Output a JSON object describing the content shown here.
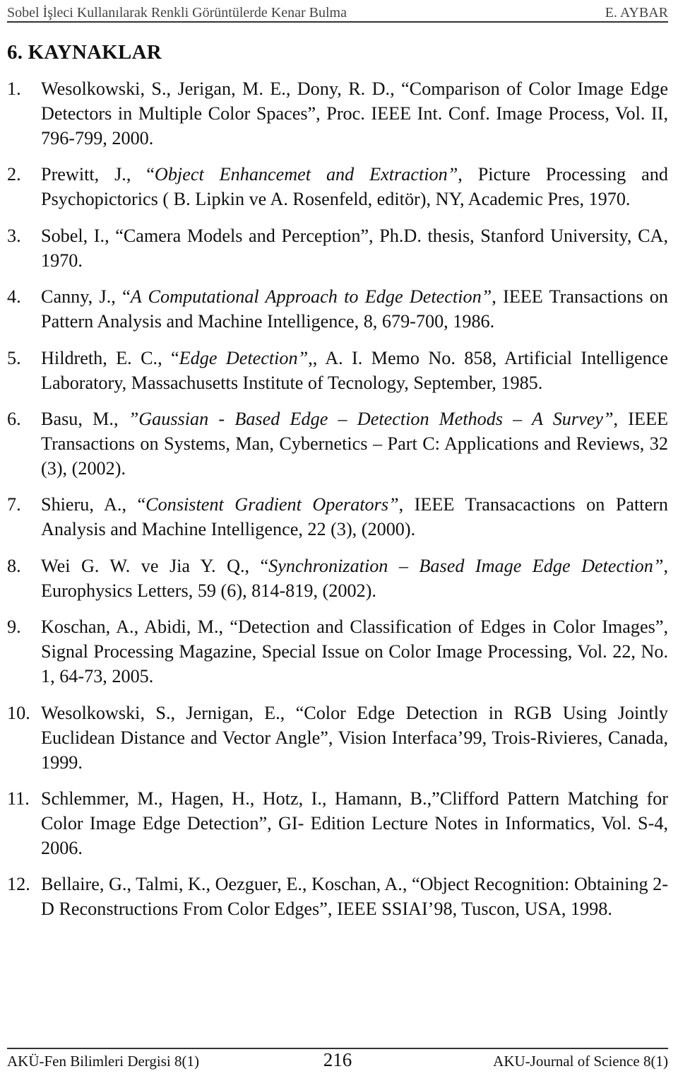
{
  "running_head": {
    "title": "Sobel İşleci Kullanılarak Renkli Görüntülerde Kenar Bulma",
    "author": "E. AYBAR"
  },
  "section_title": "6. KAYNAKLAR",
  "references": [
    {
      "number": "1.",
      "segments": [
        {
          "text": "Wesolkowski, S., Jerigan, M. E., Dony, R. D., “Comparison of Color Image Edge Detectors in Multiple Color Spaces”, Proc. IEEE Int. Conf. Image Process, Vol. II, 796-799, 2000.",
          "italic": false
        }
      ]
    },
    {
      "number": "2.",
      "segments": [
        {
          "text": "Prewitt, J., “",
          "italic": false
        },
        {
          "text": "Object Enhancemet and Extraction”",
          "italic": true
        },
        {
          "text": ", Picture Processing and Psychopictorics ( B. Lipkin ve A. Rosenfeld, editör), NY, Academic Pres, 1970.",
          "italic": false
        }
      ]
    },
    {
      "number": "3.",
      "segments": [
        {
          "text": "Sobel, I., “Camera Models and Perception”, Ph.D. thesis, Stanford University, CA, 1970.",
          "italic": false
        }
      ]
    },
    {
      "number": "4.",
      "segments": [
        {
          "text": "Canny, J., “",
          "italic": false
        },
        {
          "text": "A Computational Approach to Edge Detection”",
          "italic": true
        },
        {
          "text": ", IEEE Transactions on Pattern Analysis  and Machine Intelligence, 8, 679-700, 1986.",
          "italic": false
        }
      ]
    },
    {
      "number": "5.",
      "segments": [
        {
          "text": "Hildreth, E. C., “",
          "italic": false
        },
        {
          "text": "Edge Detection”",
          "italic": true
        },
        {
          "text": ",, A. I. Memo No. 858, Artificial Intelligence Laboratory, Massachusetts Institute of Tecnology, September, 1985.",
          "italic": false
        }
      ]
    },
    {
      "number": "6.",
      "segments": [
        {
          "text": "Basu, M., ",
          "italic": false
        },
        {
          "text": "”Gaussian - Based Edge – Detection Methods – A Survey”",
          "italic": true
        },
        {
          "text": ", IEEE Transactions on Systems, Man, Cybernetics – Part C: Applications and Reviews,  32 (3), (2002).",
          "italic": false
        }
      ]
    },
    {
      "number": "7.",
      "segments": [
        {
          "text": "Shieru, A., “",
          "italic": false
        },
        {
          "text": "Consistent Gradient Operators”",
          "italic": true
        },
        {
          "text": ", IEEE Transacactions on Pattern Analysis and Machine Intelligence, 22 (3), (2000).",
          "italic": false
        }
      ]
    },
    {
      "number": "8.",
      "segments": [
        {
          "text": "Wei G. W. ve Jia Y. Q., “",
          "italic": false
        },
        {
          "text": "Synchronization – Based Image Edge Detection”",
          "italic": true
        },
        {
          "text": ", Europhysics Letters, 59 (6), 814-819, (2002).",
          "italic": false
        }
      ]
    },
    {
      "number": "9.",
      "segments": [
        {
          "text": "Koschan, A., Abidi,  M., “Detection and Classification of Edges in Color Images”, Signal Processing Magazine, Special Issue on Color Image Processing, Vol. 22, No. 1, 64-73, 2005.",
          "italic": false
        }
      ]
    },
    {
      "number": "10.",
      "segments": [
        {
          "text": "Wesolkowski, S., Jernigan, E., “Color Edge Detection in RGB Using Jointly Euclidean Distance and Vector Angle”, Vision Interfaca’99, Trois-Rivieres, Canada, 1999.",
          "italic": false
        }
      ]
    },
    {
      "number": "11.",
      "segments": [
        {
          "text": "Schlemmer, M., Hagen, H., Hotz, I., Hamann, B.,”Clifford Pattern Matching for Color Image Edge Detection”, GI- Edition Lecture  Notes in Informatics, Vol. S-4, 2006.",
          "italic": false
        }
      ]
    },
    {
      "number": "12.",
      "segments": [
        {
          "text": "Bellaire, G., Talmi, K., Oezguer, E., Koschan, A., “Object Recognition: Obtaining 2-D Reconstructions From Color Edges”, IEEE SSIAI’98, Tuscon, USA, 1998.",
          "italic": false
        }
      ]
    }
  ],
  "footer": {
    "left": "AKÜ-Fen Bilimleri Dergisi  8(1)",
    "page_number": "216",
    "right": "AKU-Journal of Science 8(1)"
  }
}
